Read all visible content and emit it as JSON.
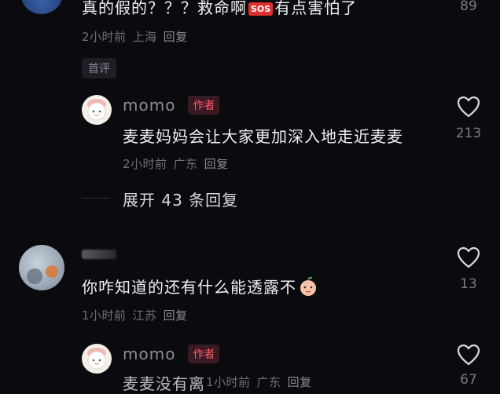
{
  "top_comment": {
    "text": "真的假的？？？救命啊",
    "emoji_label": "SOS",
    "text_after": "有点害怕了",
    "time": "2小时前",
    "location": "上海",
    "reply_label": "回复",
    "tag": "首评",
    "likes": "89"
  },
  "replies_1": {
    "username": "momo",
    "author_badge": "作者",
    "text": "麦麦妈妈会让大家更加深入地走近麦麦",
    "time": "2小时前",
    "location": "广东",
    "reply_label": "回复",
    "likes": "213",
    "expand_label": "展开 43 条回复"
  },
  "comment_2": {
    "text": "你咋知道的还有什么能透露不",
    "emoji": "peach-face-emoji",
    "time": "1小时前",
    "location": "江苏",
    "reply_label": "回复",
    "likes": "13"
  },
  "replies_2": {
    "username": "momo",
    "author_badge": "作者",
    "text": "麦麦没有离",
    "time": "1小时前",
    "location": "广东",
    "reply_label": "回复",
    "likes": "67"
  },
  "colors": {
    "background": "#0b0b0f",
    "author_red": "#ff5b6b",
    "sos_red": "#e0302e"
  }
}
